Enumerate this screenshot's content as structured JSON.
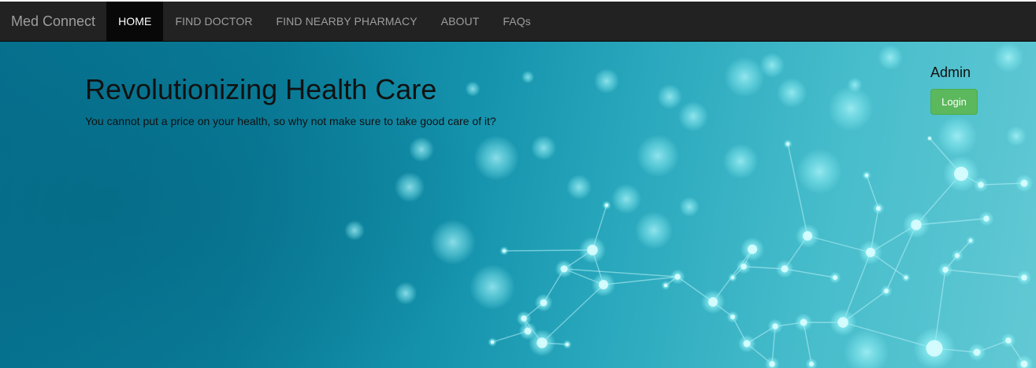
{
  "navbar": {
    "brand": "Med Connect",
    "items": [
      {
        "label": "HOME",
        "active": true
      },
      {
        "label": "FIND DOCTOR",
        "active": false
      },
      {
        "label": "FIND NEARBY PHARMACY",
        "active": false
      },
      {
        "label": "ABOUT",
        "active": false
      },
      {
        "label": "FAQs",
        "active": false
      }
    ]
  },
  "hero": {
    "title": "Revolutionizing Health Care",
    "subtitle": "You cannot put a price on your health, so why not make sure to take good care of it?",
    "background_image": "molecular-network-graphic"
  },
  "auth": {
    "admin_label": "Admin",
    "login_label": "Login"
  },
  "colors": {
    "navbar_bg": "#222222",
    "nav_active_bg": "#080808",
    "nav_text": "#9d9d9d",
    "hero_dark": "#06718f",
    "hero_light": "#62c9d4",
    "login_button": "#5cb85c"
  }
}
